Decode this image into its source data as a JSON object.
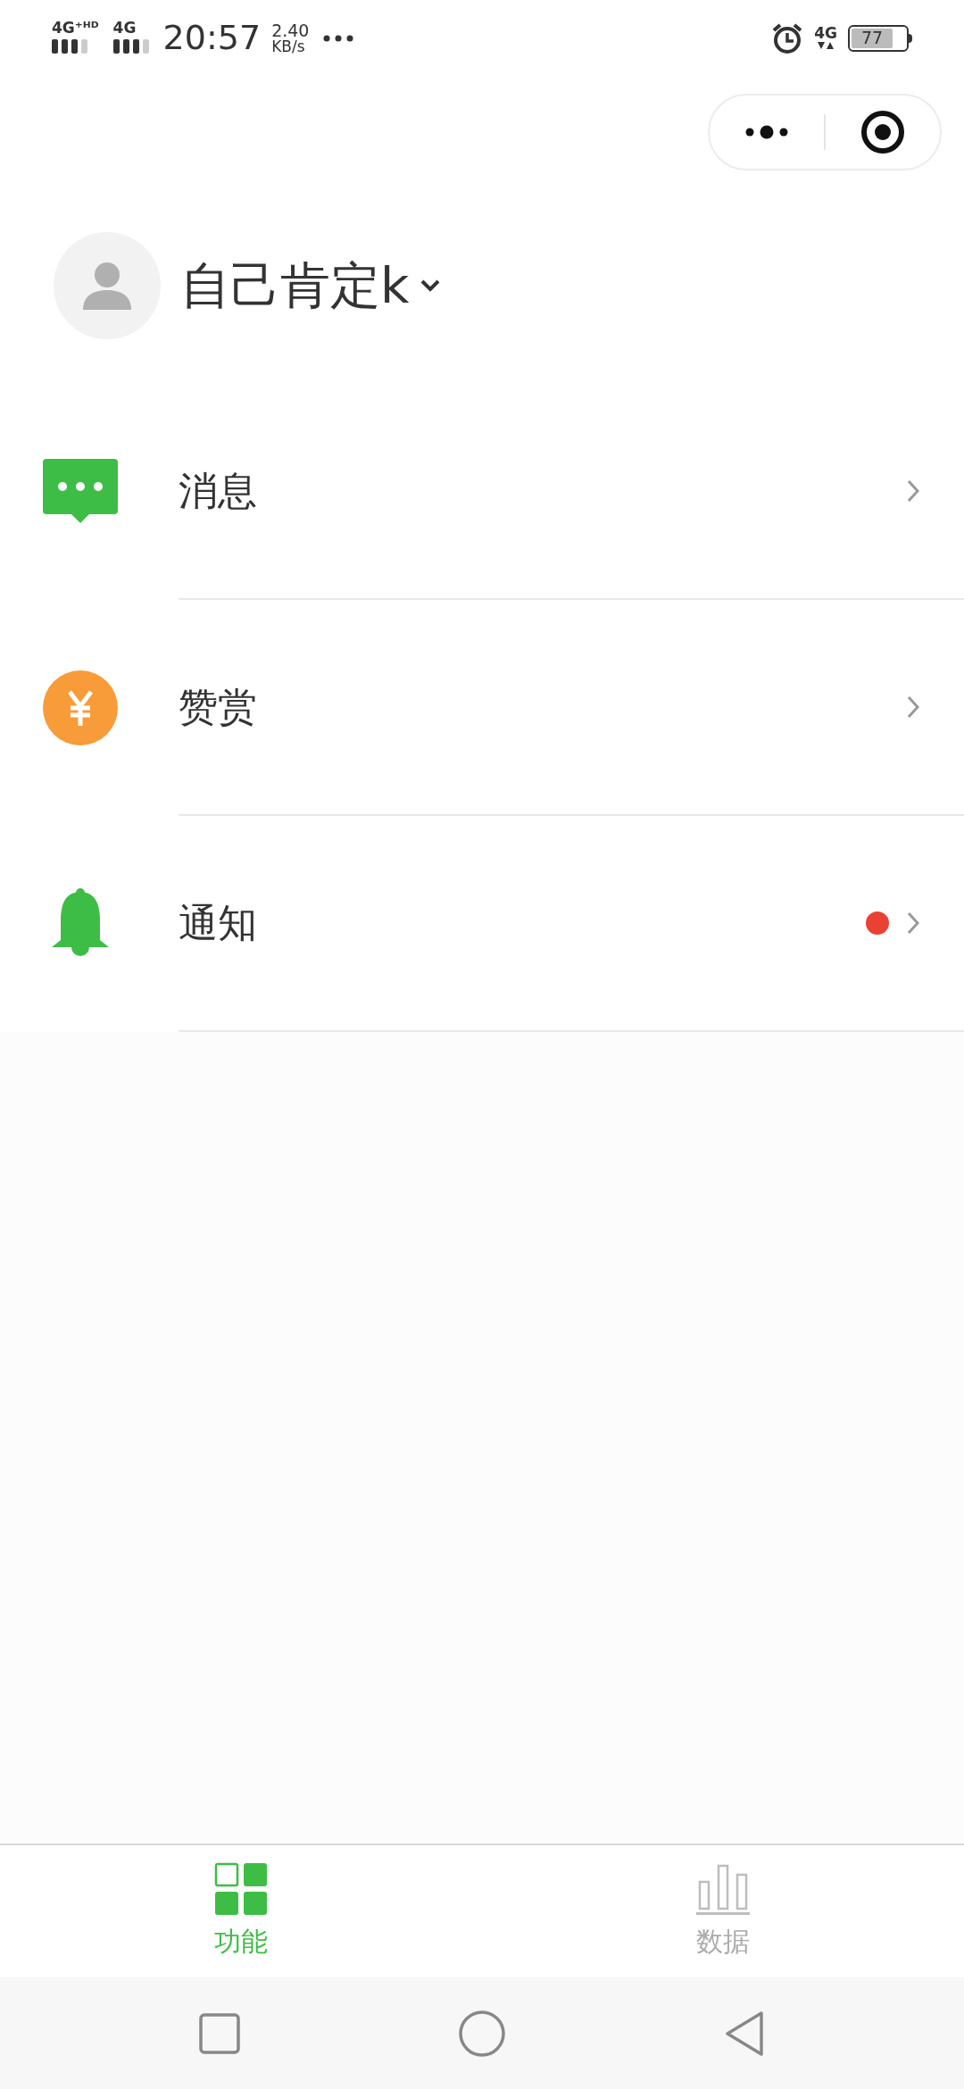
{
  "status_bar": {
    "network_1": "4G⁺ᴴᴰ",
    "network_2": "4G",
    "time": "20:57",
    "speed_value": "2.40",
    "speed_unit": "KB/s",
    "network_3": "4G",
    "battery": "77"
  },
  "profile": {
    "name": "自己肯定k"
  },
  "menu": [
    {
      "kind": "message",
      "label": "消息",
      "badge": false
    },
    {
      "kind": "reward",
      "label": "赞赏",
      "badge": false
    },
    {
      "kind": "bell",
      "label": "通知",
      "badge": true
    }
  ],
  "tabs": [
    {
      "kind": "grid",
      "label": "功能",
      "selected": true
    },
    {
      "kind": "chart",
      "label": "数据",
      "selected": false
    }
  ]
}
